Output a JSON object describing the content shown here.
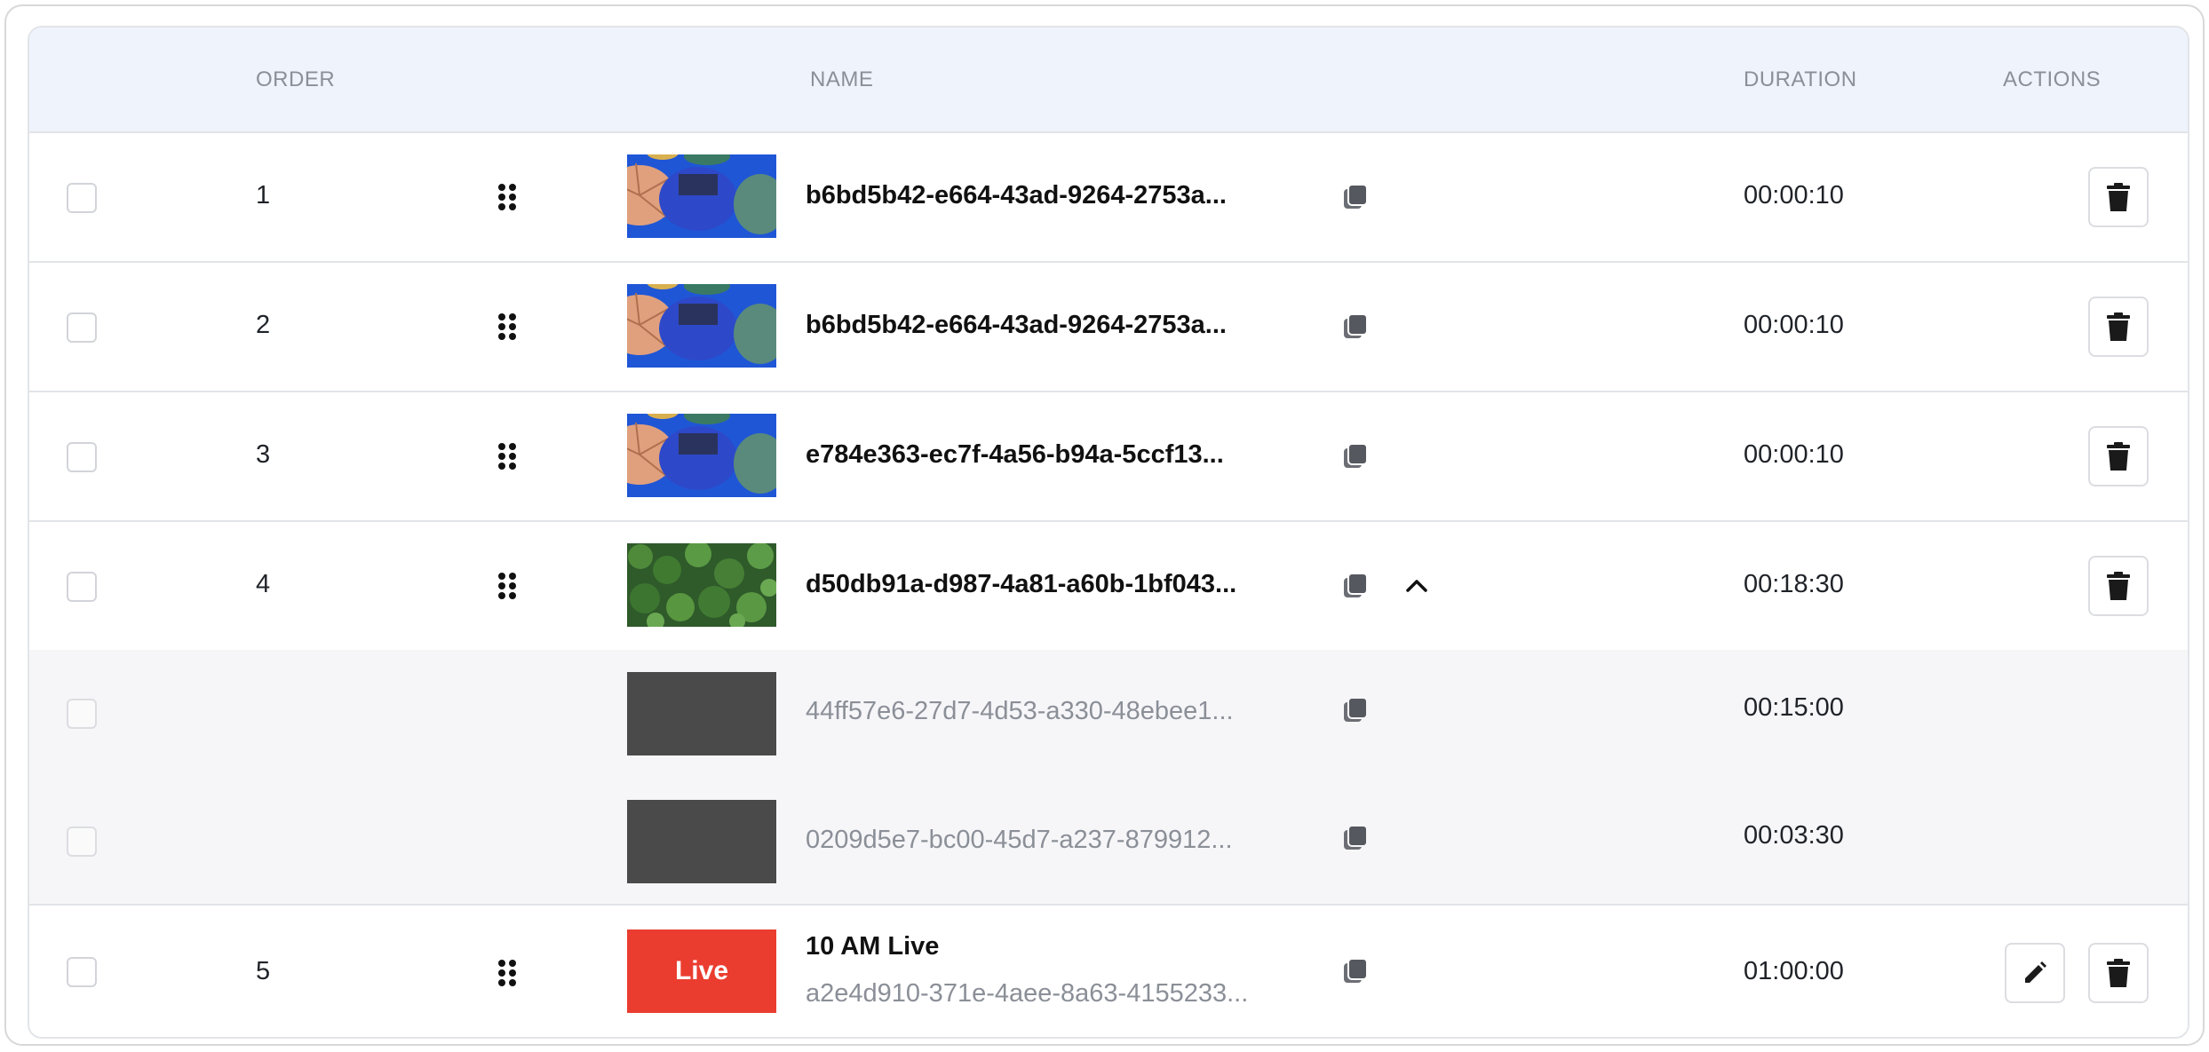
{
  "header": {
    "order": "ORDER",
    "name": "NAME",
    "duration": "DURATION",
    "actions": "ACTIONS"
  },
  "rows": [
    {
      "order": "1",
      "name": "b6bd5b42-e664-43ad-9264-2753a...",
      "duration": "00:00:10",
      "thumb": "umbrellas"
    },
    {
      "order": "2",
      "name": "b6bd5b42-e664-43ad-9264-2753a...",
      "duration": "00:00:10",
      "thumb": "umbrellas"
    },
    {
      "order": "3",
      "name": "e784e363-ec7f-4a56-b94a-5ccf13...",
      "duration": "00:00:10",
      "thumb": "umbrellas"
    },
    {
      "order": "4",
      "name": "d50db91a-d987-4a81-a60b-1bf043...",
      "duration": "00:18:30",
      "thumb": "foliage",
      "expanded": true,
      "children": [
        {
          "name": "44ff57e6-27d7-4d53-a330-48ebee1...",
          "duration": "00:15:00",
          "thumb": "dark"
        },
        {
          "name": "0209d5e7-bc00-45d7-a237-879912...",
          "duration": "00:03:30",
          "thumb": "dark"
        }
      ]
    },
    {
      "order": "5",
      "title": "10 AM Live",
      "name": "a2e4d910-371e-4aee-8a63-4155233...",
      "duration": "01:00:00",
      "thumb": "live",
      "thumb_label": "Live"
    }
  ],
  "colors": {
    "header_bg": "#eef3fc",
    "live_red": "#ea3d30",
    "sub_row_bg": "#f6f6f9"
  },
  "icons": [
    "drag-handle-icon",
    "copy-icon",
    "chevron-up-icon",
    "trash-icon",
    "pencil-icon"
  ]
}
